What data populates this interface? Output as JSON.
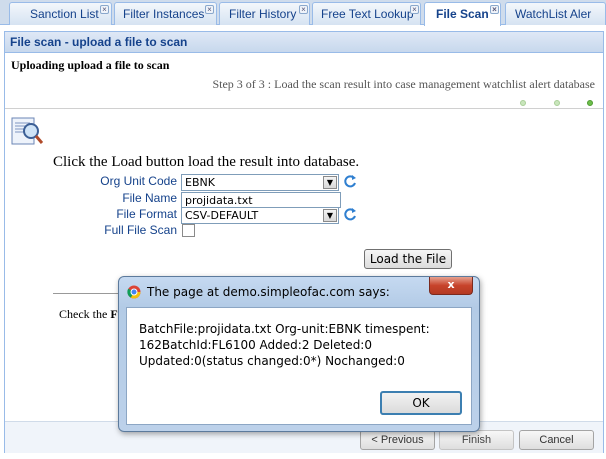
{
  "tabs": [
    {
      "label": "Sanction List",
      "active": false
    },
    {
      "label": "Filter Instances",
      "active": false
    },
    {
      "label": "Filter History",
      "active": false
    },
    {
      "label": "Free Text Lookup",
      "active": false
    },
    {
      "label": "File Scan",
      "active": true
    },
    {
      "label": "WatchList Aler",
      "active": false
    }
  ],
  "panel": {
    "title": "File scan - upload a file to scan"
  },
  "wizard": {
    "heading": "Uploading upload a file to scan",
    "step_text": "Step 3 of 3 : Load the scan result into case management watchlist alert database"
  },
  "form": {
    "instruction": "Click the Load button load the result into database.",
    "org_unit_label": "Org Unit Code",
    "org_unit_value": "EBNK",
    "file_name_label": "File Name",
    "file_name_value": "projidata.txt",
    "file_format_label": "File Format",
    "file_format_value": "CSV-DEFAULT",
    "full_scan_label": "Full File Scan",
    "load_button": "Load the File",
    "check_text_prefix": "Check the ",
    "check_text_bold": "Fu"
  },
  "nav": {
    "previous": "< Previous",
    "finish": "Finish",
    "cancel": "Cancel"
  },
  "dialog": {
    "title": "The page at demo.simpleofac.com says:",
    "message": "BatchFile:projidata.txt Org-unit:EBNK timespent: 162BatchId:FL6100 Added:2 Deleted:0 Updated:0(status changed:0*) Nochanged:0",
    "ok_label": "OK",
    "close_label": "x"
  }
}
